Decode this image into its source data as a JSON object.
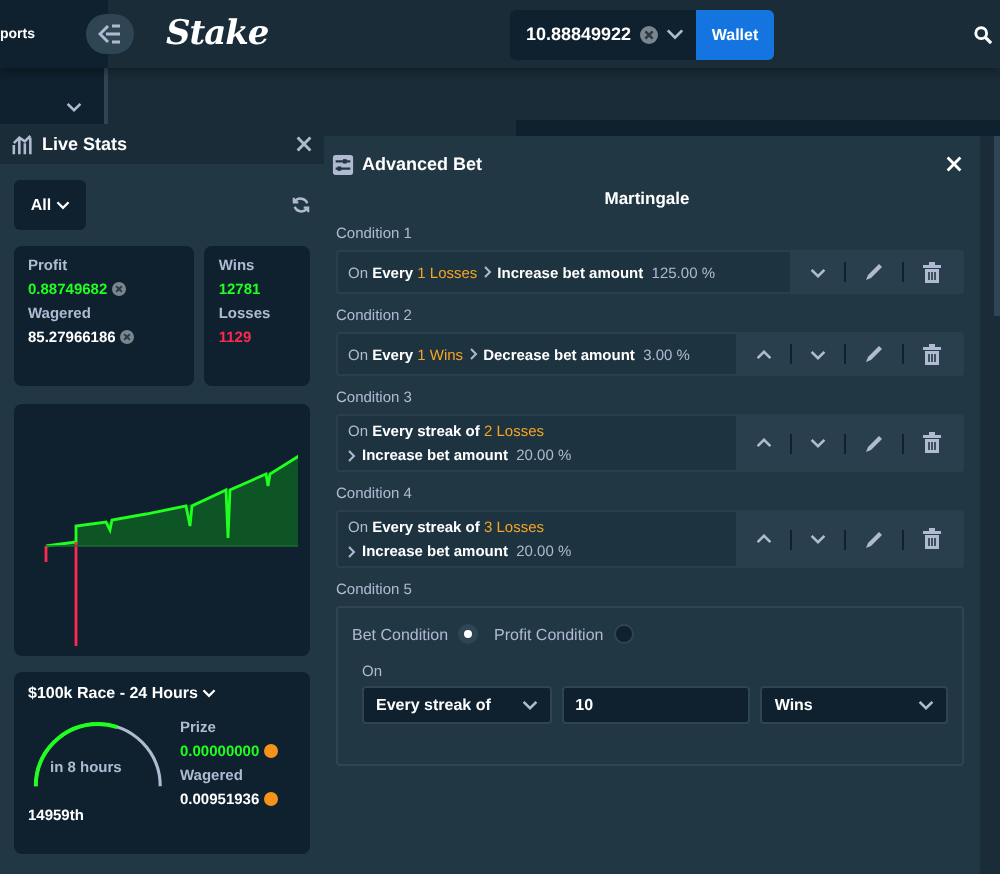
{
  "header": {
    "nav_label": "ports",
    "logo": "Stake",
    "balance": "10.88849922",
    "wallet_button": "Wallet"
  },
  "live_stats": {
    "title": "Live Stats",
    "filter": "All",
    "profit_label": "Profit",
    "profit": "0.88749682",
    "wagered_label": "Wagered",
    "wagered": "85.27966186",
    "wins_label": "Wins",
    "wins": "12781",
    "losses_label": "Losses",
    "losses": "1129",
    "race": {
      "title": "$100k Race - 24 Hours",
      "countdown": "in 8 hours",
      "rank": "14959th",
      "prize_label": "Prize",
      "prize": "0.00000000",
      "wagered_label": "Wagered",
      "wagered": "0.00951936"
    }
  },
  "advanced_bet": {
    "title": "Advanced Bet",
    "strategy": "Martingale",
    "conditions": [
      {
        "label": "Condition 1",
        "kind": "single",
        "prefix": "On",
        "trigger": "Every",
        "count": "1 Losses",
        "action": "Increase bet amount",
        "value": "125.00 %",
        "can_move_up": false
      },
      {
        "label": "Condition 2",
        "kind": "single",
        "prefix": "On",
        "trigger": "Every",
        "count": "1 Wins",
        "action": "Decrease bet amount",
        "value": "3.00 %",
        "can_move_up": true
      },
      {
        "label": "Condition 3",
        "kind": "double",
        "prefix": "On",
        "trigger": "Every streak of",
        "count": "2 Losses",
        "action": "Increase bet amount",
        "value": "20.00 %",
        "can_move_up": true
      },
      {
        "label": "Condition 4",
        "kind": "double",
        "prefix": "On",
        "trigger": "Every streak of",
        "count": "3 Losses",
        "action": "Increase bet amount",
        "value": "20.00 %",
        "can_move_up": true
      }
    ],
    "editor": {
      "label": "Condition 5",
      "options": [
        {
          "label": "Bet Condition",
          "selected": true
        },
        {
          "label": "Profit Condition",
          "selected": false
        }
      ],
      "on_label": "On",
      "mode": "Every streak of",
      "amount": "10",
      "outcome": "Wins"
    }
  }
}
